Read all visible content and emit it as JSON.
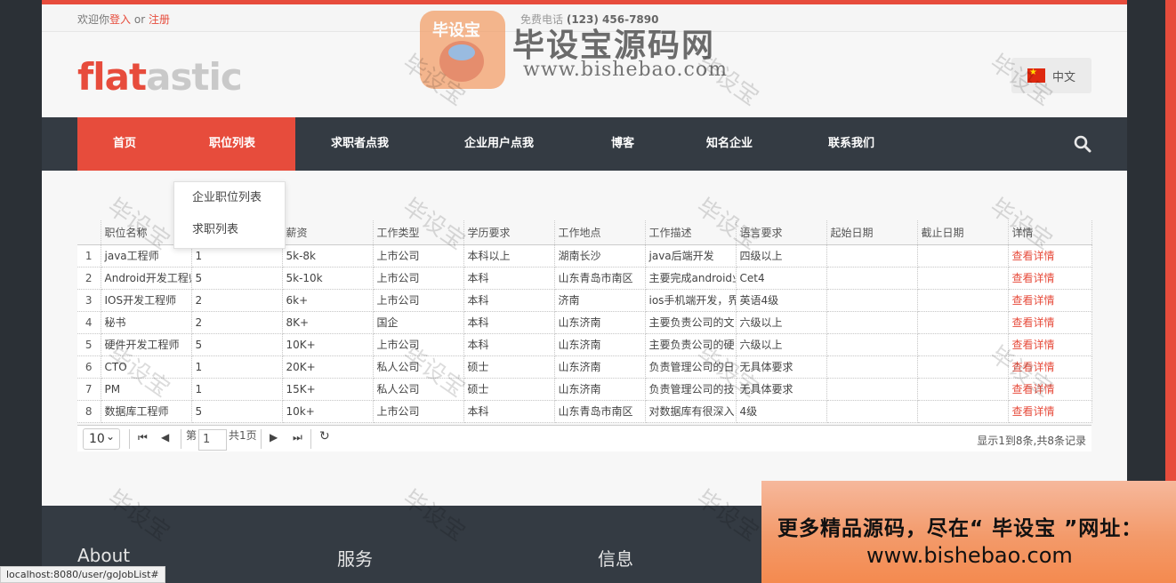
{
  "topbar": {
    "welcome_prefix": "欢迎你",
    "login": "登入",
    "or": " or ",
    "register": "注册",
    "phone_label": "免费电话",
    "phone": "(123) 456-7890"
  },
  "header": {
    "logo_a": "flat",
    "logo_b": "astic",
    "language": "中文"
  },
  "nav": {
    "items": [
      "首页",
      "职位列表",
      "求职者点我",
      "企业用户点我",
      "博客",
      "知名企业",
      "联系我们"
    ],
    "active": "首页"
  },
  "dropdown": {
    "items": [
      "企业职位列表",
      "求职列表"
    ]
  },
  "table": {
    "columns": [
      "",
      "职位名称",
      "",
      "薪资",
      "工作类型",
      "学历要求",
      "工作地点",
      "工作描述",
      "语言要求",
      "起始日期",
      "截止日期",
      "详情"
    ],
    "rows": [
      {
        "idx": "1",
        "name": "java工程师",
        "count": "1",
        "salary": "5k-8k",
        "type": "上市公司",
        "edu": "本科以上",
        "place": "湖南长沙",
        "desc": "java后端开发",
        "lang": "四级以上",
        "start": "",
        "end": "",
        "detail": "查看详情"
      },
      {
        "idx": "2",
        "name": "Android开发工程师",
        "count": "5",
        "salary": "5k-10k",
        "type": "上市公司",
        "edu": "本科",
        "place": "山东青岛市南区",
        "desc": "主要完成android业",
        "lang": "Cet4",
        "start": "",
        "end": "",
        "detail": "查看详情"
      },
      {
        "idx": "3",
        "name": "IOS开发工程师",
        "count": "2",
        "salary": "6k+",
        "type": "上市公司",
        "edu": "本科",
        "place": "济南",
        "desc": "ios手机端开发，界",
        "lang": "英语4级",
        "start": "",
        "end": "",
        "detail": "查看详情"
      },
      {
        "idx": "4",
        "name": "秘书",
        "count": "2",
        "salary": "8K+",
        "type": "国企",
        "edu": "本科",
        "place": "山东济南",
        "desc": "主要负责公司的文",
        "lang": "六级以上",
        "start": "",
        "end": "",
        "detail": "查看详情"
      },
      {
        "idx": "5",
        "name": "硬件开发工程师",
        "count": "5",
        "salary": "10K+",
        "type": "上市公司",
        "edu": "本科",
        "place": "山东济南",
        "desc": "主要负责公司的硬",
        "lang": "六级以上",
        "start": "",
        "end": "",
        "detail": "查看详情"
      },
      {
        "idx": "6",
        "name": "CTO",
        "count": "1",
        "salary": "20K+",
        "type": "私人公司",
        "edu": "硕士",
        "place": "山东济南",
        "desc": "负责管理公司的日",
        "lang": "无具体要求",
        "start": "",
        "end": "",
        "detail": "查看详情"
      },
      {
        "idx": "7",
        "name": "PM",
        "count": "1",
        "salary": "15K+",
        "type": "私人公司",
        "edu": "硕士",
        "place": "山东济南",
        "desc": "负责管理公司的技",
        "lang": "无具体要求",
        "start": "",
        "end": "",
        "detail": "查看详情"
      },
      {
        "idx": "8",
        "name": "数据库工程师",
        "count": "5",
        "salary": "10k+",
        "type": "上市公司",
        "edu": "本科",
        "place": "山东青岛市南区",
        "desc": "对数据库有很深入",
        "lang": "4级",
        "start": "",
        "end": "",
        "detail": "查看详情"
      }
    ]
  },
  "pager": {
    "page_size": "10",
    "page_prefix": "第",
    "page_value": "1",
    "page_suffix": "共1页",
    "info": "显示1到8条,共8条记录"
  },
  "footer": {
    "cols": [
      "About",
      "服务",
      "信息"
    ]
  },
  "promo": {
    "line1": "更多精品源码，尽在“ 毕设宝 ”网址：",
    "line2": "www.bishebao.com"
  },
  "watermark": {
    "text": "毕设宝",
    "logo_text": "毕设宝",
    "title": "毕设宝源码网",
    "url": "www.bishebao.com"
  },
  "statusbar": {
    "url": "localhost:8080/user/goJobList#"
  },
  "colors": {
    "accent": "#e74c3c",
    "nav_bg": "#343b43"
  }
}
